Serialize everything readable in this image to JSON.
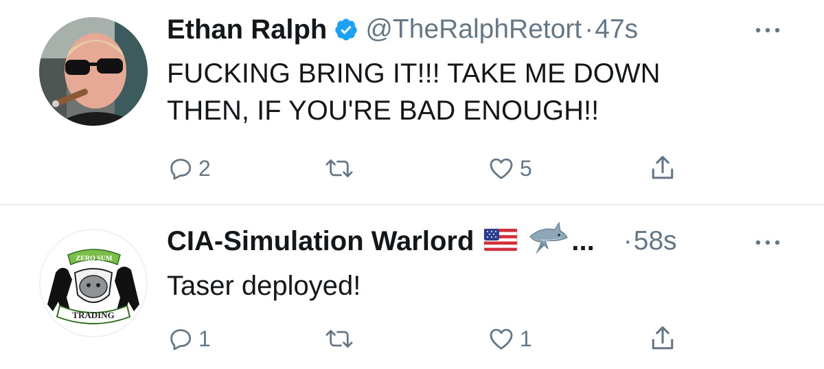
{
  "tweets": [
    {
      "display_name": "Ethan Ralph",
      "verified": true,
      "handle": "@TheRalphRetort",
      "separator": "·",
      "time": "47s",
      "text": "FUCKING BRING IT!!! TAKE ME DOWN\nTHEN, IF YOU'RE BAD ENOUGH!!",
      "reply_count": "2",
      "retweet_count": "",
      "like_count": "5",
      "avatar": "photo-man-sunglasses-cigar"
    },
    {
      "display_name": "CIA-Simulation Warlord",
      "name_emojis": [
        "us-flag-icon",
        "shark-icon"
      ],
      "truncation": "...",
      "separator": "·",
      "time": "58s",
      "text": "Taser deployed!",
      "reply_count": "1",
      "retweet_count": "",
      "like_count": "1",
      "avatar": "zero-sum-trading-logo",
      "avatar_text": {
        "top": "ZERO SUM",
        "bottom": "TRADING"
      }
    }
  ],
  "icons": {
    "reply": "reply-icon",
    "retweet": "retweet-icon",
    "like": "heart-icon",
    "share": "share-icon",
    "more": "more-icon",
    "verified": "verified-badge-icon"
  },
  "colors": {
    "text": "#14171a",
    "secondary": "#657786",
    "verified_blue": "#1da1f2",
    "divider": "#e6ecf0"
  }
}
